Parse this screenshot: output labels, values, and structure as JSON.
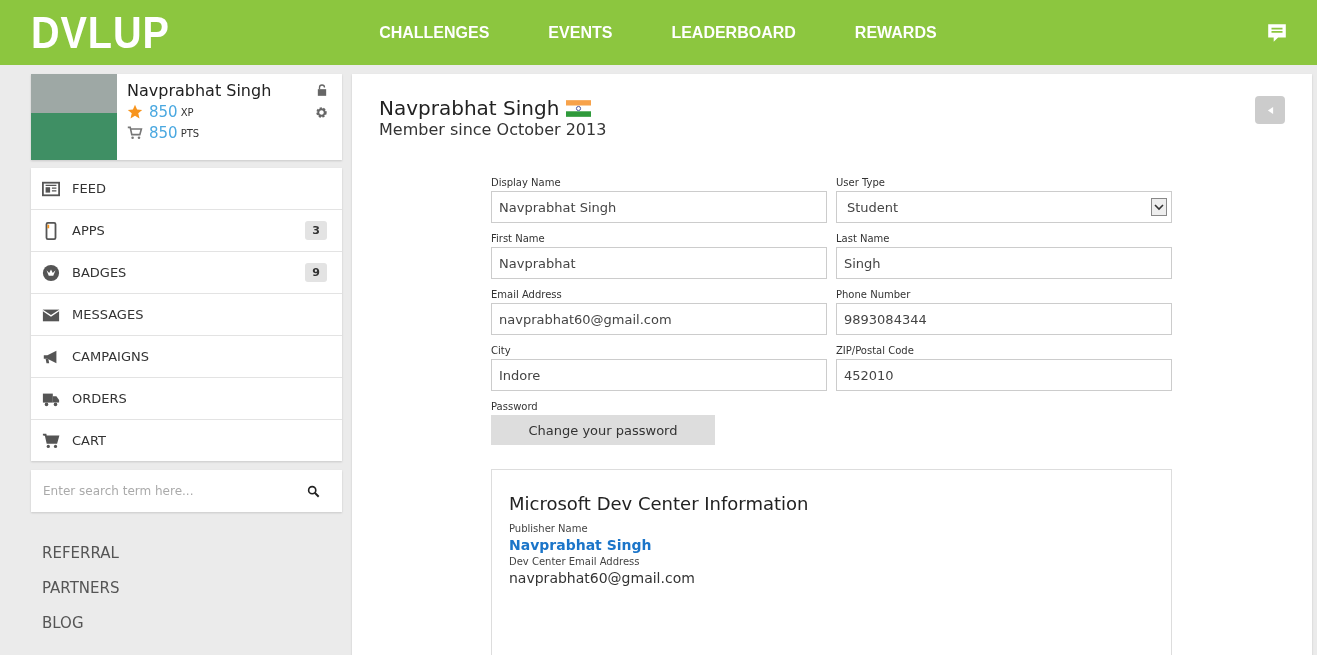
{
  "header": {
    "logo": "DVLUP",
    "nav": [
      {
        "label": "CHALLENGES"
      },
      {
        "label": "EVENTS"
      },
      {
        "label": "LEADERBOARD"
      },
      {
        "label": "REWARDS"
      }
    ]
  },
  "profile": {
    "name": "Navprabhat Singh",
    "xp": "850",
    "xp_unit": "XP",
    "points": "850",
    "points_unit": "PTS"
  },
  "menu": [
    {
      "label": "FEED"
    },
    {
      "label": "APPS",
      "count": "3"
    },
    {
      "label": "BADGES",
      "count": "9"
    },
    {
      "label": "MESSAGES"
    },
    {
      "label": "CAMPAIGNS"
    },
    {
      "label": "ORDERS"
    },
    {
      "label": "CART"
    }
  ],
  "search": {
    "placeholder": "Enter search term here..."
  },
  "links": [
    "REFERRAL",
    "PARTNERS",
    "BLOG"
  ],
  "main": {
    "name": "Navprabhat Singh",
    "member_since": "Member since October 2013",
    "fields": [
      {
        "label": "Display Name",
        "value": "Navprabhat Singh",
        "kind": "text"
      },
      {
        "label": "User Type",
        "value": "Student",
        "kind": "select"
      },
      {
        "label": "First Name",
        "value": "Navprabhat",
        "kind": "text"
      },
      {
        "label": "Last Name",
        "value": "Singh",
        "kind": "text"
      },
      {
        "label": "Email Address",
        "value": "navprabhat60@gmail.com",
        "kind": "text"
      },
      {
        "label": "Phone Number",
        "value": "9893084344",
        "kind": "text"
      },
      {
        "label": "City",
        "value": "Indore",
        "kind": "text"
      },
      {
        "label": "ZIP/Postal Code",
        "value": "452010",
        "kind": "text"
      }
    ],
    "password_label": "Password",
    "password_button": "Change your password",
    "dev_center": {
      "title": "Microsoft Dev Center Information",
      "publisher_label": "Publisher Name",
      "publisher": "Navprabhat Singh",
      "email_label": "Dev Center Email Address",
      "email": "navprabhat60@gmail.com"
    }
  }
}
